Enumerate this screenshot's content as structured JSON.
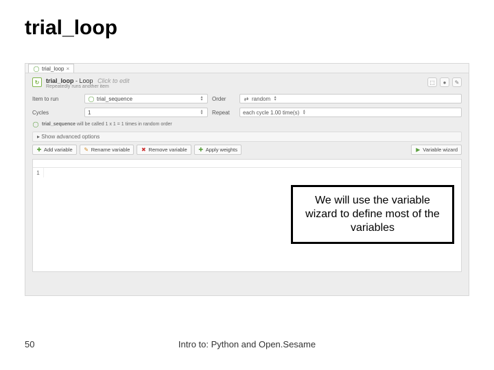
{
  "slide": {
    "title": "trial_loop",
    "page_number": 50,
    "footer": "Intro to: Python and Open.Sesame"
  },
  "app": {
    "tab_label": "trial_loop",
    "loop_name": "trial_loop",
    "loop_type": "Loop",
    "click_hint": "Click to edit",
    "subtitle": "Repeatedly runs another item",
    "labels": {
      "item_to_run": "Item to run",
      "cycles": "Cycles",
      "order": "Order",
      "repeat": "Repeat"
    },
    "fields": {
      "item_to_run": "trial_sequence",
      "cycles": "1",
      "order": "random",
      "repeat": "each cycle 1.00 time(s)"
    },
    "status_prefix": "trial_sequence",
    "status_suffix": " will be called 1 x 1 = 1 times in random order",
    "advanced": "Show advanced options",
    "buttons": {
      "add": "Add variable",
      "rename": "Rename variable",
      "remove": "Remove variable",
      "apply": "Apply weights",
      "wizard": "Variable wizard"
    },
    "table_row1": "1"
  },
  "callout": "We will use the variable wizard to define most of the variables"
}
